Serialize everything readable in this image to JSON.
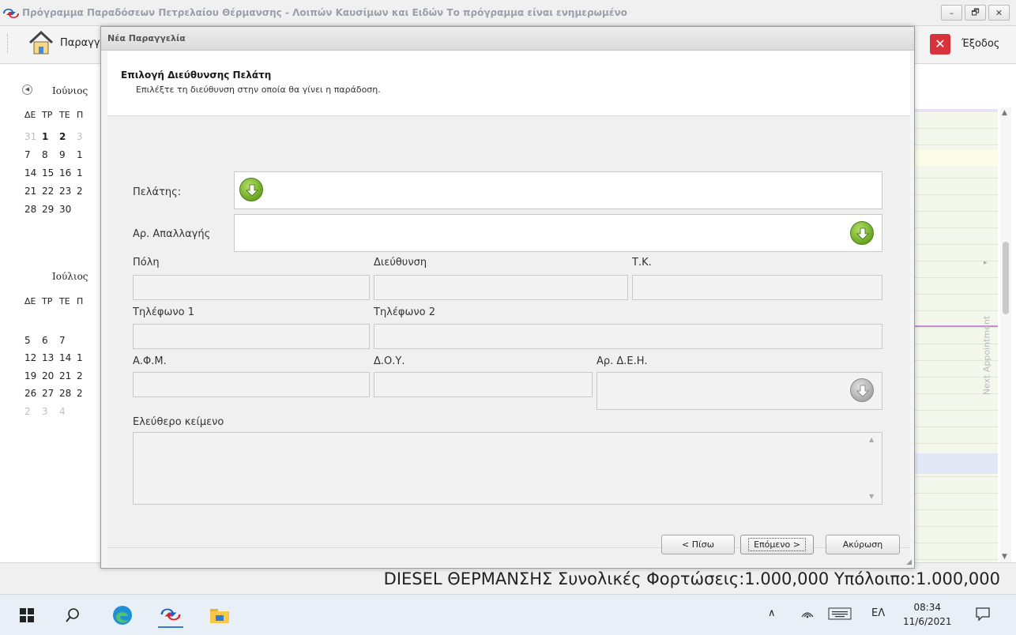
{
  "main_window": {
    "title": "Πρόγραμμα Παραδόσεων Πετρελαίου Θέρμανσης - Λοιπών Καυσίμων και Ειδών Το πρόγραμμα είναι ενημερωμένο",
    "controls": [
      "–",
      "🗗",
      "✕"
    ]
  },
  "toolbar": {
    "home_label": "Παραγγ",
    "exit_label": "Έξοδος"
  },
  "calendar": {
    "june": {
      "month": "Ιούνιος",
      "header": [
        "ΔΕ",
        "ΤΡ",
        "ΤΕ",
        "Π"
      ],
      "rows": [
        [
          "31",
          "1",
          "2",
          "3"
        ],
        [
          "7",
          "8",
          "9",
          "1"
        ],
        [
          "14",
          "15",
          "16",
          "1"
        ],
        [
          "21",
          "22",
          "23",
          "2"
        ],
        [
          "28",
          "29",
          "30",
          ""
        ]
      ]
    },
    "july": {
      "month": "Ιούλιος",
      "header": [
        "ΔΕ",
        "ΤΡ",
        "ΤΕ",
        "Π"
      ],
      "rows": [
        [
          "5",
          "6",
          "7",
          ""
        ],
        [
          "12",
          "13",
          "14",
          "1"
        ],
        [
          "19",
          "20",
          "21",
          "2"
        ],
        [
          "26",
          "27",
          "28",
          "2"
        ],
        [
          "2",
          "3",
          "4",
          ""
        ]
      ]
    }
  },
  "schedule": {
    "next_appointment": "Next Appointment"
  },
  "status_bar": {
    "text": "DIESEL ΘΕΡΜΑΝΣΗΣ Συνολικές Φορτώσεις:1.000,000 Υπόλοιπο:1.000,000"
  },
  "taskbar": {
    "language": "ΕΛ",
    "time": "08:34",
    "date": "11/6/2021"
  },
  "dialog": {
    "title": "Νέα Παραγγελία",
    "header_title": "Επιλογή Διεύθυνσης Πελάτη",
    "header_subtitle": "Επιλέξτε τη διεύθυνση στην οποία θα γίνει η παράδοση.",
    "labels": {
      "customer": "Πελάτης:",
      "exemption_no": "Αρ. Απαλλαγής",
      "city": "Πόλη",
      "address": "Διεύθυνση",
      "postal_code": "Τ.Κ.",
      "phone1": "Τηλέφωνο 1",
      "phone2": "Τηλέφωνο 2",
      "afm": "Α.Φ.Μ.",
      "doy": "Δ.Ο.Υ.",
      "dei_no": "Αρ. Δ.Ε.Η.",
      "free_text": "Ελεύθερο κείμενο"
    },
    "values": {
      "customer": "",
      "exemption_no": "",
      "city": "",
      "address": "",
      "postal_code": "",
      "phone1": "",
      "phone2": "",
      "afm": "",
      "doy": "",
      "dei_no": "",
      "free_text": ""
    },
    "buttons": {
      "back": "< Πίσω",
      "next": "Επόμενο >",
      "cancel": "Ακύρωση"
    }
  },
  "colors": {
    "green_button": "#6aa61f",
    "exit_red": "#d8323b",
    "schedule_purple_line": "#c58fd6"
  }
}
